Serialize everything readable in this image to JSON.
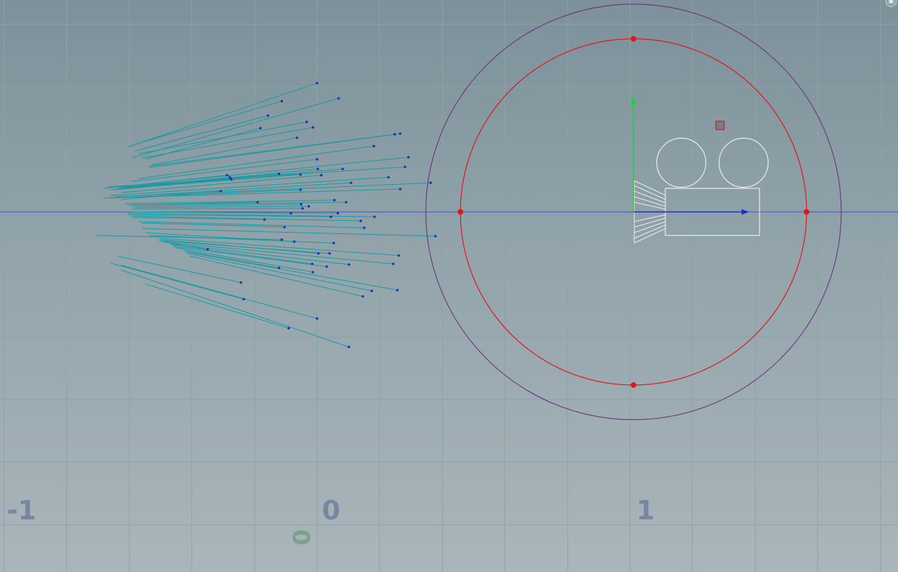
{
  "axis_labels": {
    "x_minus_one": "-1",
    "x_zero": "0",
    "x_one": "1"
  },
  "origin_marker": "0",
  "colors": {
    "background_top": "#7c919a",
    "background_bottom": "#a9b6bb",
    "grid": "#8fa0a7",
    "x_axis": "#4a4cd8",
    "ray": "#179aa3",
    "point": "#1631b8",
    "inner_circle": "#e0161b",
    "outer_circle": "#6e3a7e",
    "camera_outline": "#e9eef0",
    "up_vector": "#1fcf3a",
    "forward_vector": "#1b2bd6"
  },
  "icons": {
    "camera": "movie-camera-icon",
    "corner_button": "viewport-options-icon"
  },
  "corner_button_glyph": "▣"
}
